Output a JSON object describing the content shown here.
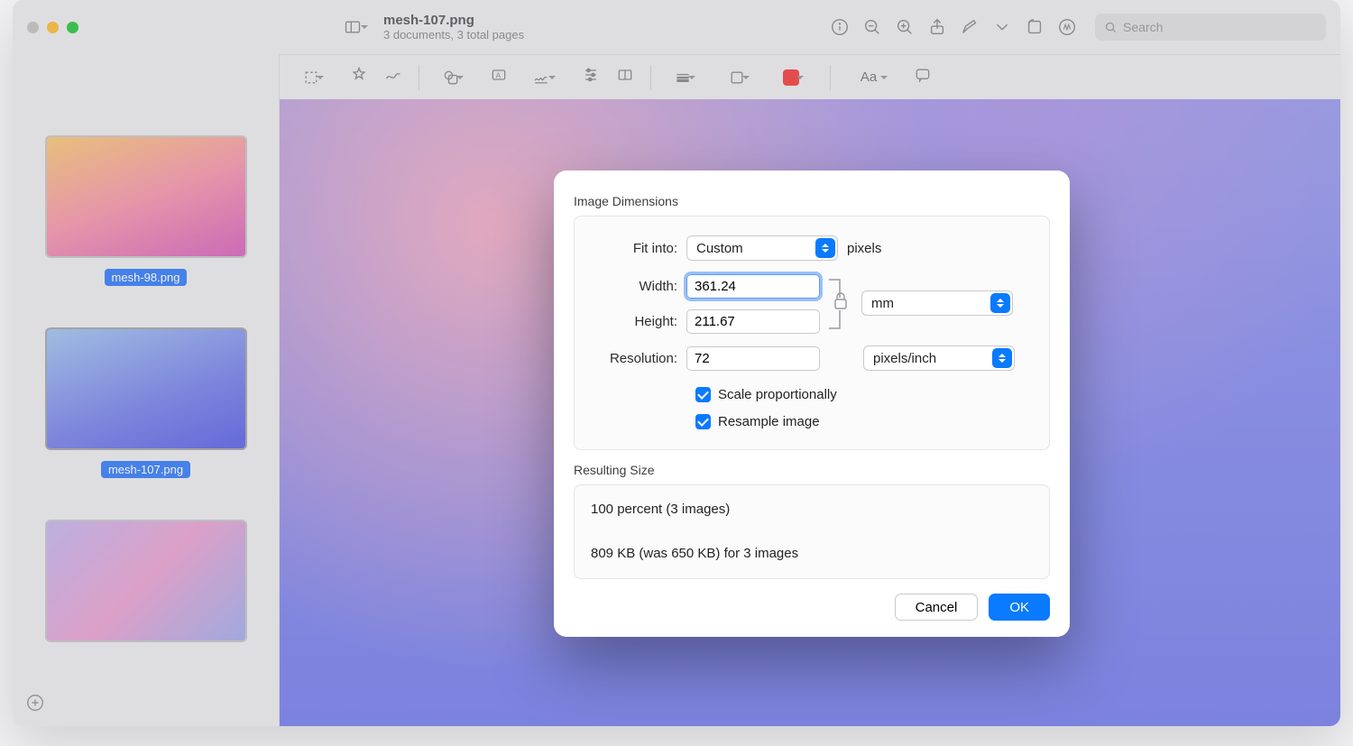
{
  "window": {
    "title": "mesh-107.png",
    "subtitle": "3 documents, 3 total pages",
    "search_placeholder": "Search"
  },
  "sidebar": {
    "thumbnails": [
      {
        "label": "mesh-98.png"
      },
      {
        "label": "mesh-107.png"
      },
      {
        "label": ""
      }
    ]
  },
  "dialog": {
    "section_dimensions": "Image Dimensions",
    "fit_into_label": "Fit into:",
    "fit_into_value": "Custom",
    "fit_into_unit": "pixels",
    "width_label": "Width:",
    "width_value": "361.24",
    "height_label": "Height:",
    "height_value": "211.67",
    "wh_unit": "mm",
    "resolution_label": "Resolution:",
    "resolution_value": "72",
    "resolution_unit": "pixels/inch",
    "scale_label": "Scale proportionally",
    "resample_label": "Resample image",
    "section_result": "Resulting Size",
    "result_percent": "100 percent (3 images)",
    "result_size": "809 KB (was 650 KB) for 3 images",
    "cancel": "Cancel",
    "ok": "OK"
  },
  "toolbar2": {
    "font_label": "Aa"
  }
}
